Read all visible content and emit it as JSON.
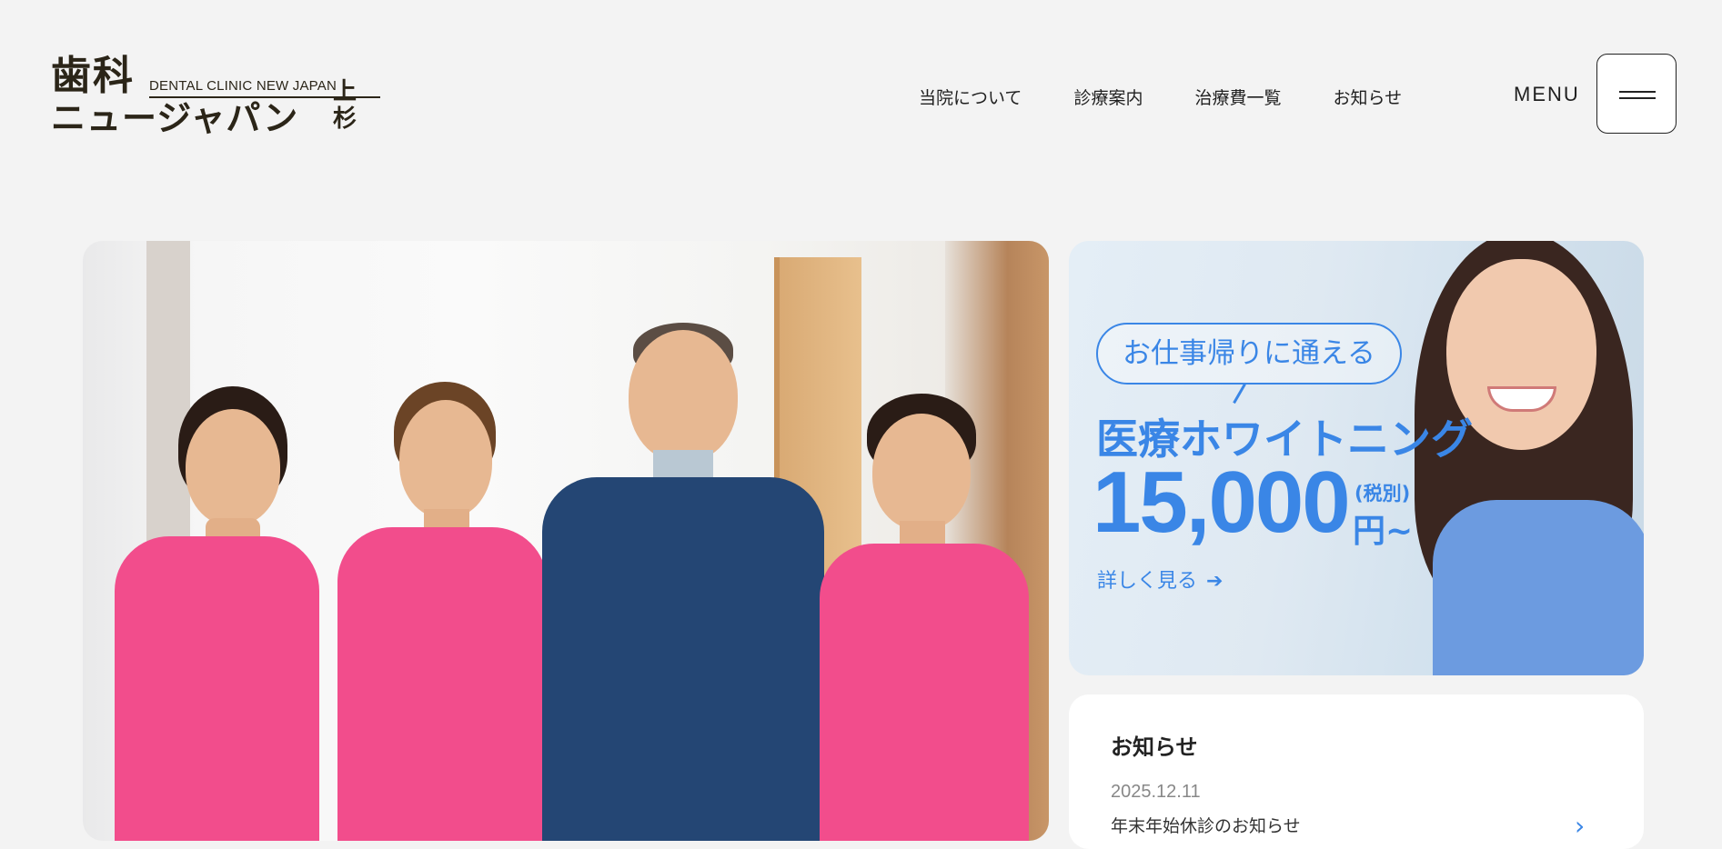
{
  "header": {
    "logo": {
      "kanji": "歯科",
      "english": "DENTAL CLINIC NEW JAPAN",
      "kana": "ニュージャパン",
      "branch": "上杉"
    },
    "nav": [
      "当院について",
      "診療案内",
      "治療費一覧",
      "お知らせ"
    ],
    "menu_label": "MENU"
  },
  "promo": {
    "pill": "お仕事帰りに通える",
    "headline": "医療ホワイトニング",
    "price": "15,000",
    "tax": "(税別)",
    "yen": "円~",
    "more": "詳しく見る",
    "more_icon": "arrow-right-icon",
    "accent_color": "#3a86e6"
  },
  "news": {
    "title": "お知らせ",
    "items": [
      {
        "date": "2025.12.11",
        "text": "年末年始休診のお知らせ"
      }
    ]
  }
}
